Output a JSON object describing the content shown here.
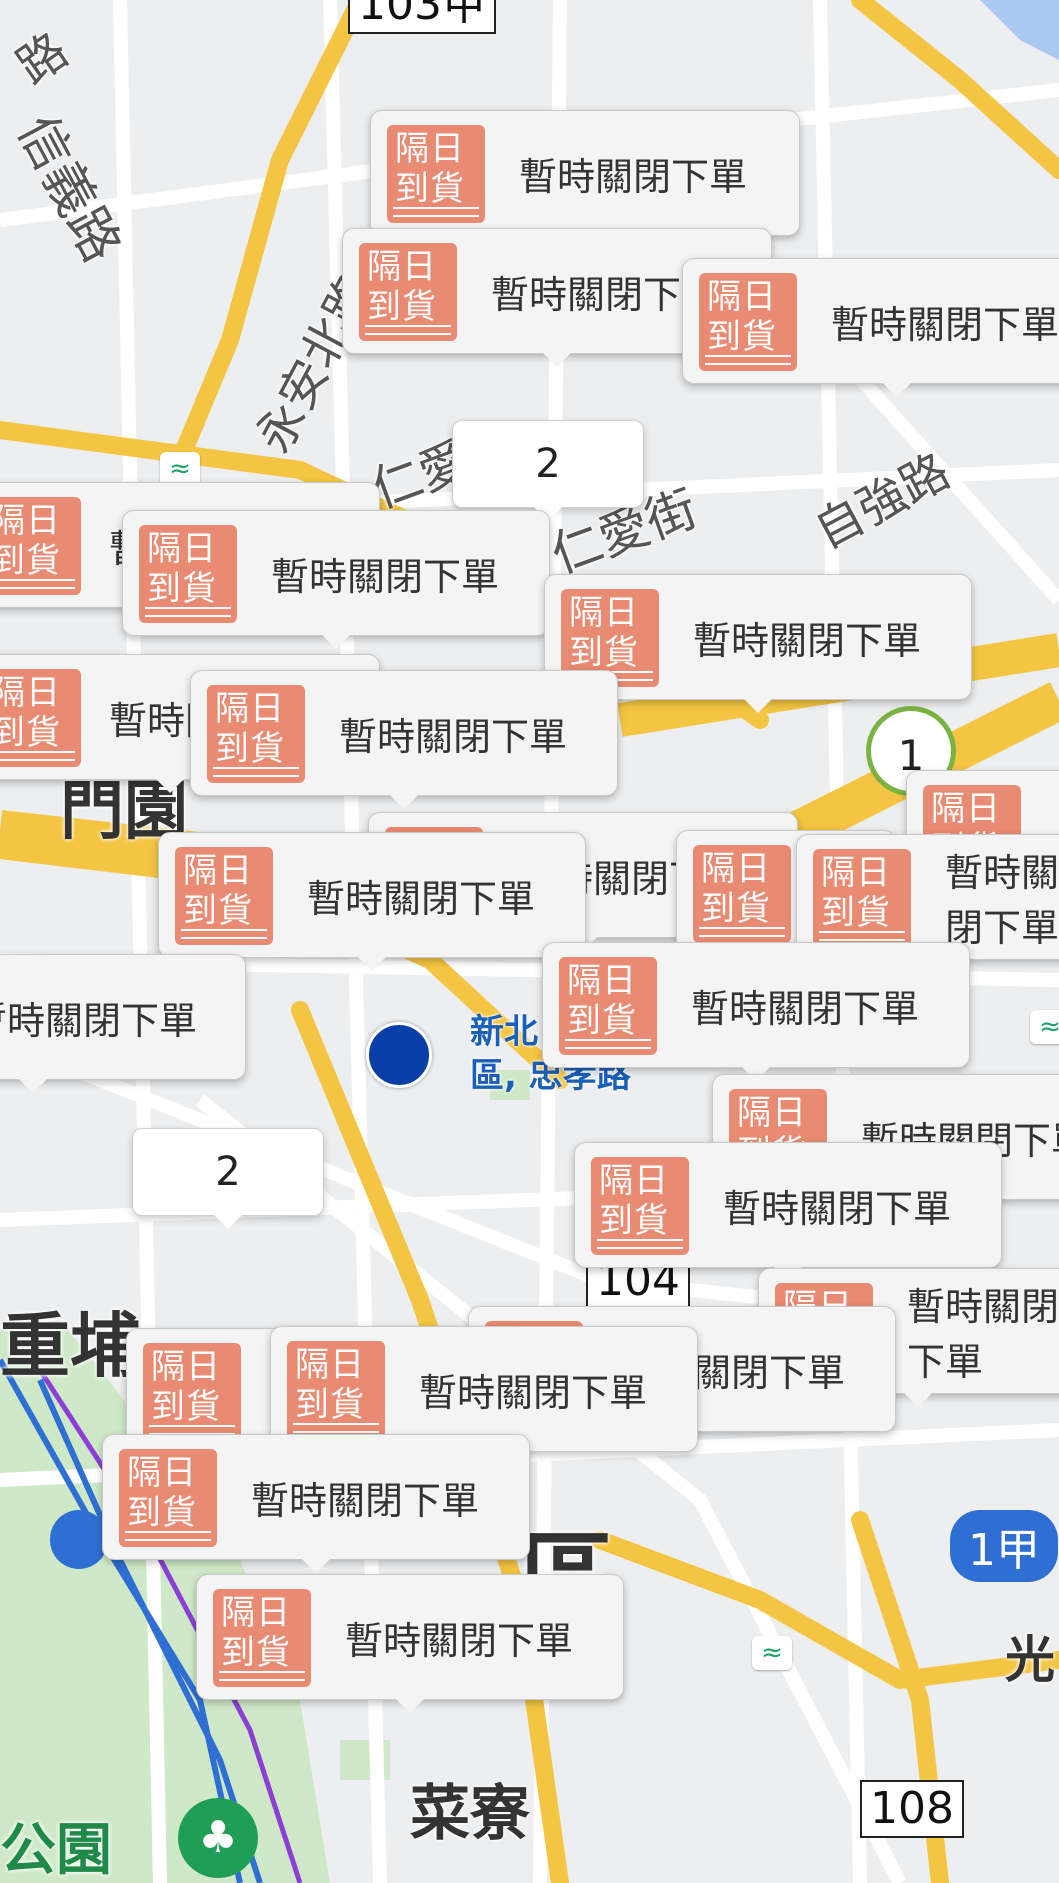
{
  "streets": {
    "xinyi": "信義路",
    "yongan": "永安北路",
    "renai": "仁愛街",
    "renai2": "仁愛街",
    "ziqiang": "自強路",
    "road_top_left": "路"
  },
  "districts": {
    "sanchong": "重埔",
    "central": "區",
    "caiiao": "菜寮",
    "park": "公園",
    "guang": "光",
    "menyuan": "門園"
  },
  "shields": {
    "top": "103甲",
    "mid": "104",
    "bottom": "108"
  },
  "highway": {
    "label": "1甲"
  },
  "current_location": {
    "line1": "新北",
    "line2": "區, 忠孝路"
  },
  "badge": {
    "line1": "隔日",
    "line2": "到貨"
  },
  "store_status": "暫時關閉下單",
  "cluster_counts": {
    "a": "2",
    "b": "2",
    "c": "1"
  },
  "icons": {
    "metro": "metro-station-icon",
    "park": "park-tree-icon"
  },
  "colors": {
    "badge": "#e98a72",
    "location_dot": "#0a3ea8",
    "highway": "#2f6fd3",
    "road_major": "#f4c542"
  }
}
